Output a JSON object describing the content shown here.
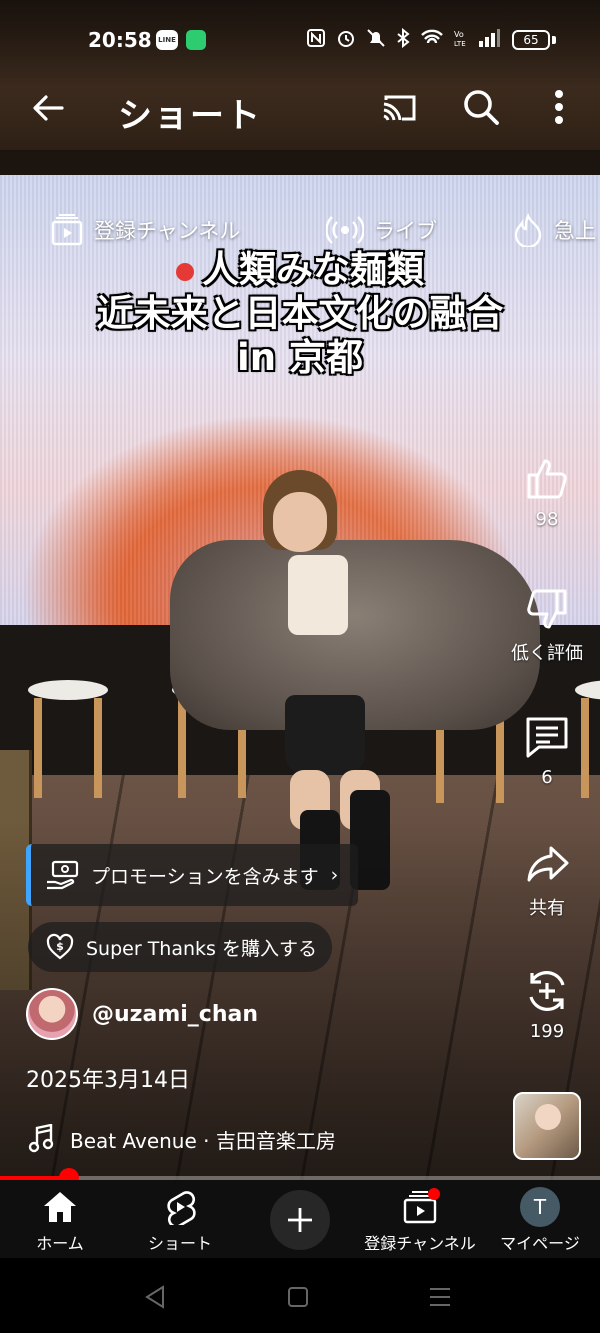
{
  "status_bar": {
    "time": "20:58",
    "line_badge": "LINE",
    "battery_level": "65"
  },
  "app_bar": {
    "title": "ショート"
  },
  "chips": [
    {
      "label": "登録チャンネル",
      "icon": "subscriptions-icon"
    },
    {
      "label": "ライブ",
      "icon": "live-icon"
    },
    {
      "label": "急上",
      "icon": "trending-icon"
    }
  ],
  "caption": {
    "line1": "人類みな麺類",
    "line2": "近未来と日本文化の融合",
    "line3": "in 京都"
  },
  "actions": {
    "like_count": "98",
    "dislike_label": "低く評価",
    "comment_count": "6",
    "share_label": "共有",
    "remix_count": "199"
  },
  "promo": {
    "label": "プロモーションを含みます",
    "chevron": "›"
  },
  "super_thanks": {
    "label": "Super Thanks を購入する"
  },
  "channel": {
    "handle": "@uzami_chan"
  },
  "video": {
    "date": "2025年3月14日",
    "music": "Beat Avenue · 吉田音楽工房",
    "progress": 0.115
  },
  "bottom_nav": {
    "home": "ホーム",
    "shorts": "ショート",
    "subscriptions": "登録チャンネル",
    "you": "マイページ",
    "avatar_letter": "T"
  },
  "colors": {
    "accent_red": "#ff0000",
    "promo_bar": "#3ea6ff",
    "nav_bg": "#0f0f0f"
  }
}
